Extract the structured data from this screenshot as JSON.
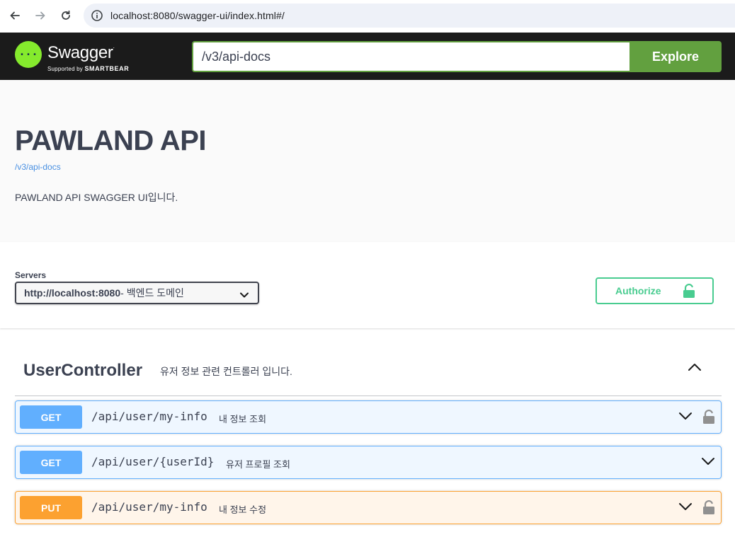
{
  "browser": {
    "url": "localhost:8080/swagger-ui/index.html#/",
    "back_icon": "arrow-left-icon",
    "forward_icon": "arrow-right-icon",
    "reload_icon": "reload-icon",
    "site_info_icon": "info-circle-icon"
  },
  "topbar": {
    "logo_title": "Swagger",
    "logo_tm": ".",
    "logo_supported": "Supported by",
    "logo_brand": "SMARTBEAR",
    "explore_input_value": "/v3/api-docs",
    "explore_label": "Explore",
    "colors": {
      "background": "#1b1b1b",
      "accent": "#62a03f",
      "logo": "#85ea2d"
    }
  },
  "info": {
    "title": "PAWLAND API",
    "url": "/v3/api-docs",
    "description": "PAWLAND API SWAGGER UI입니다."
  },
  "servers": {
    "label": "Servers",
    "selected": "http://localhost:8080",
    "selected_desc": " - 백엔드 도메인",
    "authorize_label": "Authorize",
    "authorize_color": "#49cc90"
  },
  "tag": {
    "name": "UserController",
    "description": "유저 정보 관련 컨트롤러 입니다.",
    "expanded": true
  },
  "operations": [
    {
      "method": "GET",
      "path": "/api/user/my-info",
      "summary": "내 정보 조회",
      "locked": true,
      "color": "#61affe"
    },
    {
      "method": "GET",
      "path": "/api/user/{userId}",
      "summary": "유저 프로필 조회",
      "locked": false,
      "color": "#61affe"
    },
    {
      "method": "PUT",
      "path": "/api/user/my-info",
      "summary": "내 정보 수정",
      "locked": true,
      "color": "#fca130"
    }
  ]
}
